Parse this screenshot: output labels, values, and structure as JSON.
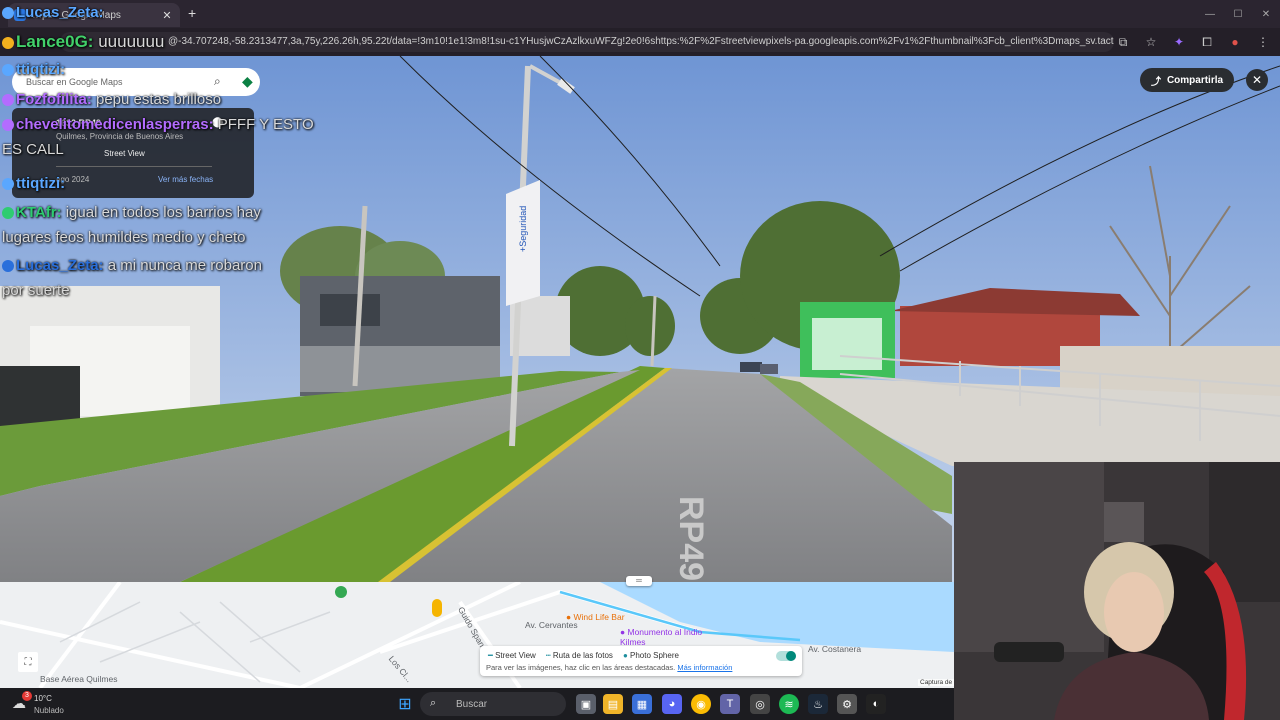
{
  "browser": {
    "tab_title": "…ps - Google Maps",
    "url": "@-34.707248,-58.2313477,3a,75y,226.26h,95.22t/data=!3m10!1e1!3m8!1su-c1YHusjwCzAzlkxuWFZg!2e0!6shttps:%2F%2Fstreetviewpixels-pa.googleapis.com%2Fv1%2Fthumbnail%3Fcb_client%3Dmaps_sv.tactile%26w%3D900…",
    "new_tab_label": "+",
    "tab_close_label": "✕"
  },
  "streetview": {
    "share_label": "Compartirla",
    "close_label": "✕",
    "road_marking": "RP49",
    "billboard_text": "+Seguridad"
  },
  "maps_panel": {
    "search_placeholder": "Buscar en Google Maps",
    "address": "1632 RP49",
    "locality": "Quilmes, Provincia de Buenos Aires",
    "street_view_label": "Street View",
    "capture_date": "ago 2024",
    "more_dates": "Ver más fechas"
  },
  "chat": [
    {
      "user": "ttiqtizi:",
      "user_color": "#5aa7ff",
      "text": ""
    },
    {
      "user": "Fozfofilita:",
      "user_color": "#b36cff",
      "text": " pepu estas brilloso"
    },
    {
      "user": "chevelitomedicenlasperras:",
      "user_color": "#b36cff",
      "text": " PFFF Y ESTO"
    },
    {
      "user": "",
      "user_color": "#d9d9d9",
      "text": "ES CALL"
    },
    {
      "user": "ttiqtizi:",
      "user_color": "#5aa7ff",
      "text": ""
    },
    {
      "user": "KTAfr:",
      "user_color": "#2ecc71",
      "text": " igual en todos los barrios hay"
    },
    {
      "user": "",
      "user_color": "#d9d9d9",
      "text": "lugares feos humildes medio y cheto"
    },
    {
      "user": "Lucas_Zeta:",
      "user_color": "#2a6fdb",
      "text": " a mi nunca me robaron"
    },
    {
      "user": "",
      "user_color": "#d9d9d9",
      "text": "por suerte"
    }
  ],
  "chat_top": {
    "user1": "Lucas_Zeta:",
    "user2": "Lance0G:",
    "text2": " uuuuuuu"
  },
  "map": {
    "labels": [
      "Av. Cervantes",
      "Guido Spano",
      "Los Cl...",
      "Av. Costanera",
      "Base Aérea Quilmes"
    ],
    "pois": [
      "Wind Life Bar",
      "Monumento al Indio Kilmes"
    ],
    "legend_street_view": "Street View",
    "legend_ruta": "Ruta de las fotos",
    "legend_sphere": "Photo Sphere",
    "legend_hint": "Para ver las imágenes, haz clic en las áreas destacadas.",
    "legend_link": "Más información",
    "attribution": "Captura de"
  },
  "taskbar": {
    "weather_temp": "10°C",
    "weather_desc": "Nublado",
    "weather_badge": "3",
    "search_placeholder": "Buscar"
  },
  "colors": {
    "sky_top": "#6f95d4",
    "sky_bottom": "#b9cdea",
    "road": "#8c8d90",
    "grass": "#6b9b3a",
    "map_bg": "#eef0f2",
    "accent_teal": "#00897b"
  }
}
